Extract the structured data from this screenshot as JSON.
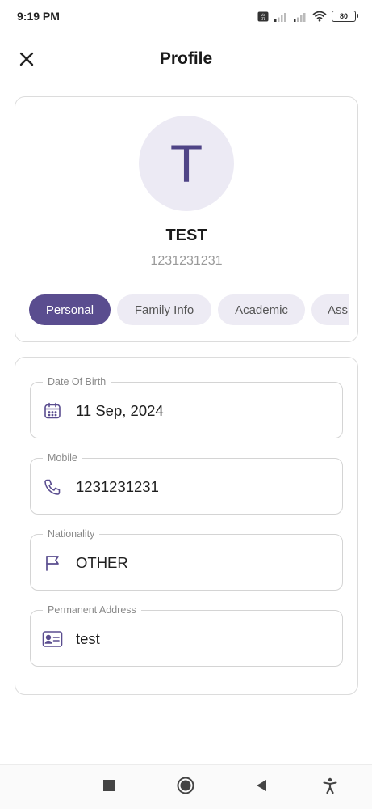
{
  "status_bar": {
    "time": "9:19 PM",
    "battery_level": "80",
    "icons": [
      "volte-icon",
      "signal-icon",
      "signal-icon",
      "wifi-icon",
      "battery-icon"
    ]
  },
  "header": {
    "title": "Profile",
    "close_icon": "close-icon"
  },
  "profile": {
    "avatar_initial": "T",
    "name": "TEST",
    "id_number": "1231231231"
  },
  "tabs": [
    {
      "label": "Personal",
      "active": true
    },
    {
      "label": "Family Info",
      "active": false
    },
    {
      "label": "Academic",
      "active": false
    },
    {
      "label": "Assi",
      "active": false
    }
  ],
  "fields": [
    {
      "label": "Date Of Birth",
      "value": "11 Sep, 2024",
      "icon": "calendar-icon"
    },
    {
      "label": "Mobile",
      "value": "1231231231",
      "icon": "phone-icon"
    },
    {
      "label": "Nationality",
      "value": "OTHER",
      "icon": "flag-icon"
    },
    {
      "label": "Permanent Address",
      "value": "test",
      "icon": "id-card-icon"
    }
  ],
  "nav_bar": {
    "buttons": [
      "recents-icon",
      "home-icon",
      "back-icon",
      "accessibility-icon"
    ]
  },
  "colors": {
    "accent": "#5a4d8f",
    "avatar_bg": "#eceaf4",
    "tab_bg": "#edebf4",
    "icon": "#5a4d8f"
  }
}
